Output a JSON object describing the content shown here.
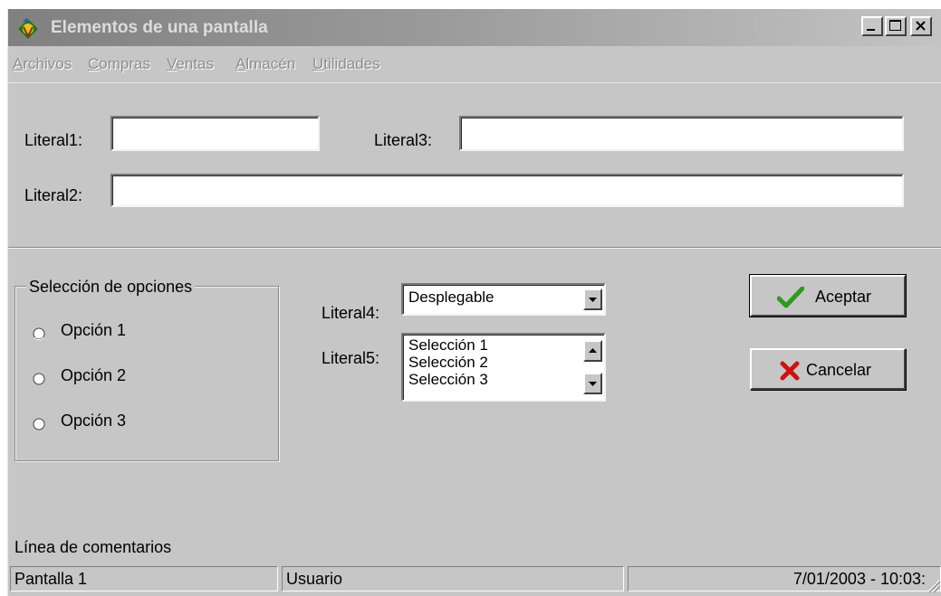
{
  "window": {
    "title": "Elementos de una pantalla",
    "icon": "app-icon",
    "controls": {
      "minimize": "minimize-icon",
      "maximize": "maximize-icon",
      "close": "close-icon"
    }
  },
  "menu": {
    "items": [
      {
        "label": "Archivos"
      },
      {
        "label": "Compras"
      },
      {
        "label": "Ventas"
      },
      {
        "label": "Almacén"
      },
      {
        "label": "Utilidades"
      }
    ]
  },
  "form": {
    "literal1": {
      "label": "Literal1:",
      "value": ""
    },
    "literal2": {
      "label": "Literal2:",
      "value": ""
    },
    "literal3": {
      "label": "Literal3:",
      "value": ""
    },
    "literal4": {
      "label": "Literal4:",
      "selected": "Desplegable"
    },
    "literal5": {
      "label": "Literal5:",
      "items": [
        "Selección 1",
        "Selección 2",
        "Selección 3"
      ]
    }
  },
  "options": {
    "title": "Selección de opciones",
    "items": [
      {
        "label": "Opción 1",
        "checked": false
      },
      {
        "label": "Opción 2",
        "checked": false
      },
      {
        "label": "Opción 3",
        "checked": false
      }
    ]
  },
  "buttons": {
    "accept": {
      "label": "Aceptar",
      "icon": "checkmark-icon",
      "color": "#2e9a1e"
    },
    "cancel": {
      "label": "Cancelar",
      "icon": "x-icon",
      "color": "#d01010"
    }
  },
  "comment_line": "Línea de comentarios",
  "status": {
    "screen": "Pantalla 1",
    "user": "Usuario",
    "empty": "",
    "datetime": "7/01/2003 - 10:03:"
  }
}
